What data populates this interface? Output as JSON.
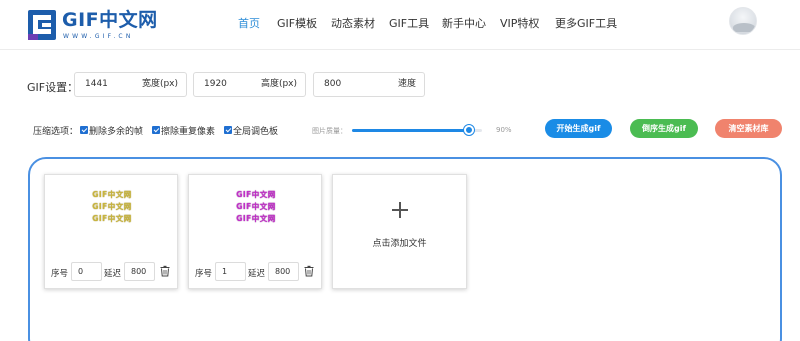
{
  "header": {
    "logo_text": "GIF中文网",
    "logo_sub": "WWW.GIF.CN",
    "nav": [
      "首页",
      "GIF模板",
      "动态素材",
      "GIF工具",
      "新手中心",
      "VIP特权",
      "更多GIF工具"
    ],
    "active_nav": "首页"
  },
  "settings": {
    "label": "GIF设置：",
    "width": {
      "value": "1441",
      "unit": "宽度(px)"
    },
    "height": {
      "value": "1920",
      "unit": "高度(px)"
    },
    "speed": {
      "value": "800",
      "unit": "速度"
    }
  },
  "compression": {
    "label": "压缩选项：",
    "options": [
      {
        "label": "删除多余的帧",
        "checked": true
      },
      {
        "label": "擦除重复像素",
        "checked": true
      },
      {
        "label": "全局调色板",
        "checked": true
      }
    ],
    "quality_label": "图片质量：",
    "quality_value": "90%",
    "quality_fraction": 0.9
  },
  "actions": {
    "generate": "开始生成gif",
    "reverse": "倒序生成gif",
    "clear": "清空素材库"
  },
  "frames": [
    {
      "gif_text": "GIF中文网",
      "lines": 3,
      "color": "#c9b53d",
      "order_label": "序号",
      "order": "0",
      "delay_label": "延迟",
      "delay": "800"
    },
    {
      "gif_text": "GIF中文网",
      "lines": 3,
      "color": "#c22fc9",
      "order_label": "序号",
      "order": "1",
      "delay_label": "延迟",
      "delay": "800"
    }
  ],
  "add_file": {
    "label": "点击添加文件"
  },
  "colors": {
    "accent": "#2f8ed8",
    "brand": "#1d5dab",
    "blue": "#1a8ce6",
    "green": "#4bbc52",
    "red": "#f0836d"
  }
}
